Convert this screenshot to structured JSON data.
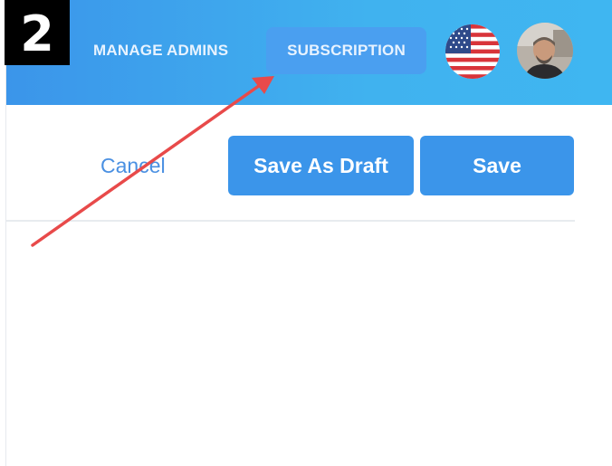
{
  "step_badge": "2",
  "header": {
    "nav": {
      "manage_admins": "MANAGE ADMINS",
      "subscription": "SUBSCRIPTION"
    },
    "language_icon": "us-flag-icon",
    "avatar_icon": "user-avatar"
  },
  "toolbar": {
    "cancel_label": "Cancel",
    "save_draft_label": "Save As Draft",
    "save_label": "Save"
  },
  "colors": {
    "header_gradient_start": "#3b95ea",
    "header_gradient_end": "#3fb6f1",
    "button_primary": "#3b95ea",
    "link": "#4a90e2",
    "annotation_arrow": "#e84a4a"
  }
}
